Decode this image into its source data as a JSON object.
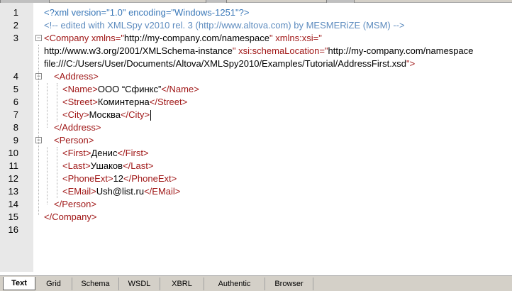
{
  "lines": [
    {
      "num": "1",
      "tokens": [
        {
          "t": "<?xml version=\"1.0\" encoding=\"Windows-1251\"?>",
          "c": "pi"
        }
      ]
    },
    {
      "num": "2",
      "tokens": [
        {
          "t": "<!-- edited with XMLSpy v2010 rel. 3 (http://www.altova.com) by MESMERiZE (MSM) -->",
          "c": "cm"
        }
      ]
    },
    {
      "num": "3",
      "tokens": [
        {
          "t": "<Company ",
          "c": "tg"
        },
        {
          "t": "xmlns",
          "c": "an"
        },
        {
          "t": "=\"",
          "c": "an"
        },
        {
          "t": "http://my-company.com/namespace",
          "c": "av"
        },
        {
          "t": "\" ",
          "c": "an"
        },
        {
          "t": "xmlns:xsi",
          "c": "an"
        },
        {
          "t": "=\"",
          "c": "an"
        }
      ]
    },
    {
      "num": "",
      "tokens": [
        {
          "t": "http://www.w3.org/2001/XMLSchema-instance",
          "c": "av"
        },
        {
          "t": "\" ",
          "c": "an"
        },
        {
          "t": "xsi:schemaLocation",
          "c": "an"
        },
        {
          "t": "=\"",
          "c": "an"
        },
        {
          "t": "http://my-company.com/namespace",
          "c": "av"
        }
      ]
    },
    {
      "num": "",
      "tokens": [
        {
          "t": "file:///C:/Users/User/Documents/Altova/XMLSpy2010/Examples/Tutorial/AddressFirst.xsd",
          "c": "av"
        },
        {
          "t": "\">",
          "c": "tg"
        }
      ]
    },
    {
      "num": "4",
      "tokens": [
        {
          "t": "<Address>",
          "c": "tg"
        }
      ]
    },
    {
      "num": "5",
      "tokens": [
        {
          "t": "<Name>",
          "c": "tg"
        },
        {
          "t": "OOO “Сфинкс”",
          "c": "tx"
        },
        {
          "t": "</Name>",
          "c": "tg"
        }
      ]
    },
    {
      "num": "6",
      "tokens": [
        {
          "t": "<Street>",
          "c": "tg"
        },
        {
          "t": "Коминтерна",
          "c": "tx"
        },
        {
          "t": "</Street>",
          "c": "tg"
        }
      ]
    },
    {
      "num": "7",
      "tokens": [
        {
          "t": "<City>",
          "c": "tg"
        },
        {
          "t": "Москва",
          "c": "tx"
        },
        {
          "t": "</City>",
          "c": "tg"
        }
      ]
    },
    {
      "num": "8",
      "tokens": [
        {
          "t": "</Address>",
          "c": "tg"
        }
      ]
    },
    {
      "num": "9",
      "tokens": [
        {
          "t": "<Person>",
          "c": "tg"
        }
      ]
    },
    {
      "num": "10",
      "tokens": [
        {
          "t": "<First>",
          "c": "tg"
        },
        {
          "t": "Денис",
          "c": "tx"
        },
        {
          "t": "</First>",
          "c": "tg"
        }
      ]
    },
    {
      "num": "11",
      "tokens": [
        {
          "t": "<Last>",
          "c": "tg"
        },
        {
          "t": "Ушаков",
          "c": "tx"
        },
        {
          "t": "</Last>",
          "c": "tg"
        }
      ]
    },
    {
      "num": "12",
      "tokens": [
        {
          "t": "<PhoneExt>",
          "c": "tg"
        },
        {
          "t": "12",
          "c": "tx"
        },
        {
          "t": "</PhoneExt>",
          "c": "tg"
        }
      ]
    },
    {
      "num": "13",
      "tokens": [
        {
          "t": "<EMail>",
          "c": "tg"
        },
        {
          "t": "Ush@list.ru",
          "c": "tx"
        },
        {
          "t": "</EMail>",
          "c": "tg"
        }
      ]
    },
    {
      "num": "14",
      "tokens": [
        {
          "t": "</Person>",
          "c": "tg"
        }
      ]
    },
    {
      "num": "15",
      "tokens": [
        {
          "t": "</Company>",
          "c": "tg"
        }
      ]
    },
    {
      "num": "16",
      "tokens": []
    }
  ],
  "tabs": [
    "Text",
    "Grid",
    "Schema",
    "WSDL",
    "XBRL",
    "Authentic",
    "Browser"
  ],
  "active_tab": "Text",
  "colors": {
    "tag": "#a01818",
    "processing_instruction": "#3a78b8",
    "comment": "#5e8cbf",
    "text": "#000000",
    "gutter": "#e8e8e8"
  }
}
